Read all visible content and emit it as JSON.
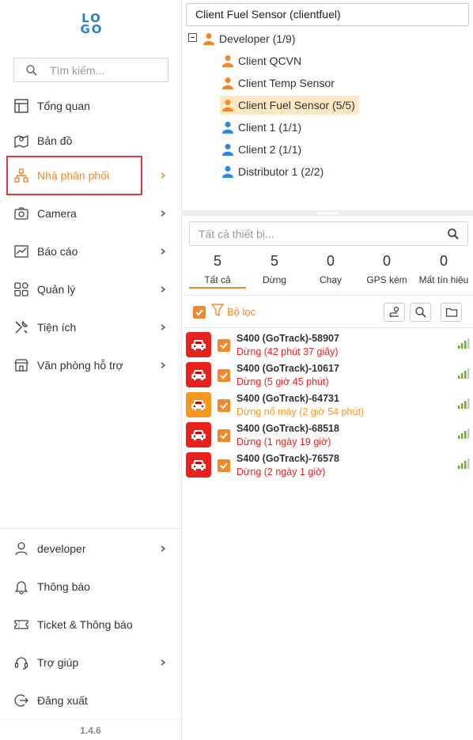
{
  "logo": {
    "line1": "LO",
    "line2": "GO"
  },
  "sidebar": {
    "search_placeholder": "Tìm kiếm...",
    "items": [
      {
        "label": "Tổng quan",
        "icon": "dashboard-icon",
        "has_chevron": false
      },
      {
        "label": "Bản đồ",
        "icon": "map-icon",
        "has_chevron": false
      },
      {
        "label": "Nhà phân phối",
        "icon": "hierarchy-icon",
        "has_chevron": true,
        "active": true
      },
      {
        "label": "Camera",
        "icon": "camera-icon",
        "has_chevron": true
      },
      {
        "label": "Báo cáo",
        "icon": "chart-icon",
        "has_chevron": true
      },
      {
        "label": "Quản lý",
        "icon": "grid-icon",
        "has_chevron": true
      },
      {
        "label": "Tiện ích",
        "icon": "tools-icon",
        "has_chevron": true
      },
      {
        "label": "Văn phòng hỗ trợ",
        "icon": "store-icon",
        "has_chevron": true
      }
    ],
    "bottom_items": [
      {
        "label": "developer",
        "icon": "user-icon",
        "has_chevron": true
      },
      {
        "label": "Thông báo",
        "icon": "bell-icon",
        "has_chevron": false
      },
      {
        "label": "Ticket & Thông báo",
        "icon": "ticket-icon",
        "has_chevron": false
      },
      {
        "label": "Trợ giúp",
        "icon": "headset-icon",
        "has_chevron": true
      },
      {
        "label": "Đăng xuất",
        "icon": "logout-icon",
        "has_chevron": false
      }
    ],
    "version": "1.4.6"
  },
  "account_select": {
    "value": "Client Fuel Sensor (clientfuel)"
  },
  "tree": {
    "root": {
      "label": "Developer (1/9)",
      "icon": "user-orange-icon"
    },
    "children": [
      {
        "label": "Client QCVN",
        "color": "orange"
      },
      {
        "label": "Client Temp Sensor",
        "color": "orange"
      },
      {
        "label": "Client Fuel Sensor (5/5)",
        "color": "orange",
        "selected": true
      },
      {
        "label": "Client 1 (1/1)",
        "color": "blue"
      },
      {
        "label": "Client 2 (1/1)",
        "color": "blue"
      },
      {
        "label": "Distributor 1 (2/2)",
        "color": "blue"
      }
    ]
  },
  "device_search": {
    "placeholder": "Tất cả thiết bị..."
  },
  "stats": [
    {
      "count": "5",
      "label": "Tất cả",
      "active": true
    },
    {
      "count": "5",
      "label": "Dừng"
    },
    {
      "count": "0",
      "label": "Chạy"
    },
    {
      "count": "0",
      "label": "GPS kém"
    },
    {
      "count": "0",
      "label": "Mất tín hiệu"
    }
  ],
  "filter": {
    "label": "Bộ lọc"
  },
  "devices": [
    {
      "name": "S400 (GoTrack)-58907",
      "status": "Dừng (42 phút 37 giây)",
      "state": "stopped"
    },
    {
      "name": "S400 (GoTrack)-10617",
      "status": "Dừng (5 giờ 45 phút)",
      "state": "stopped"
    },
    {
      "name": "S400 (GoTrack)-64731",
      "status": "Dừng nổ máy (2 giờ 54 phút)",
      "state": "idle"
    },
    {
      "name": "S400 (GoTrack)-68518",
      "status": "Dừng (1 ngày 19 giờ)",
      "state": "stopped"
    },
    {
      "name": "S400 (GoTrack)-76578",
      "status": "Dừng (2 ngày 1 giờ)",
      "state": "stopped"
    }
  ],
  "colors": {
    "accent": "#f0892c",
    "stopped": "#e8211d",
    "idle": "#f7961d",
    "signal": "#6ab023",
    "active_border": "#e53935",
    "user_blue": "#2e86de"
  }
}
